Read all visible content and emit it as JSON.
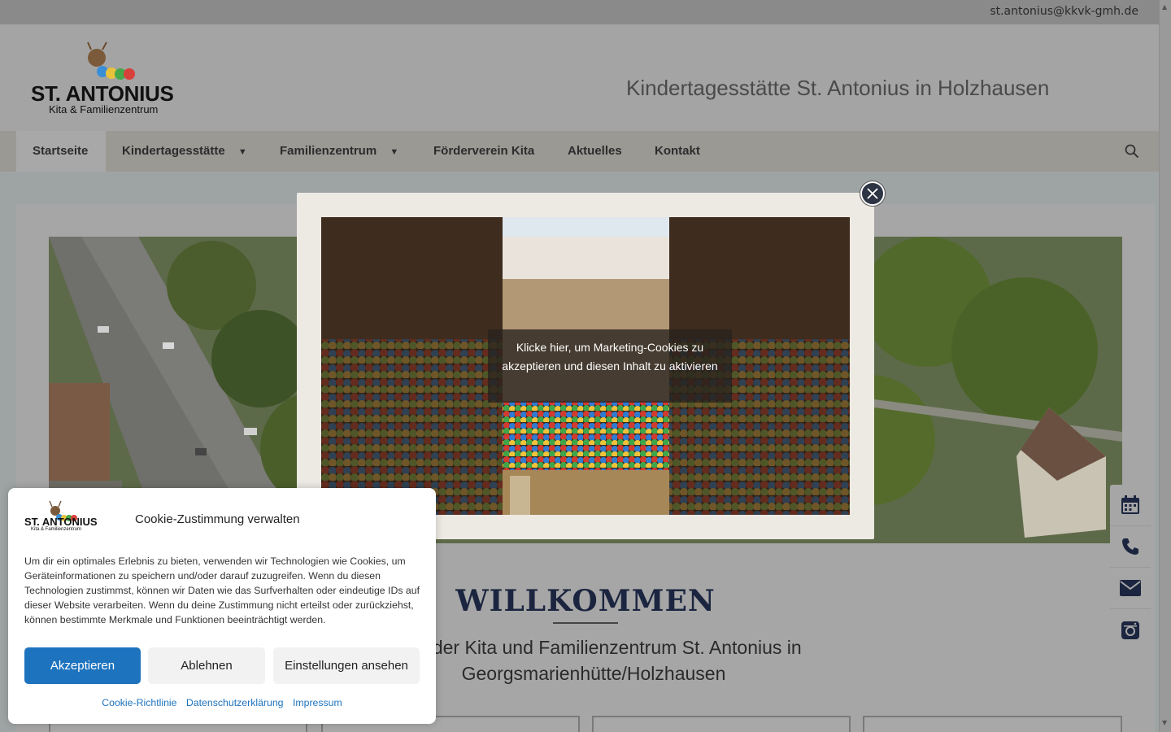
{
  "topbar": {
    "email": "st.antonius@kkvk-gmh.de"
  },
  "header": {
    "logo_name": "ST. ANTONIUS",
    "logo_sub": "Kita & Familienzentrum",
    "site_title": "Kindertagesstätte St. Antonius in Holzhausen"
  },
  "nav": {
    "items": [
      {
        "label": "Startseite"
      },
      {
        "label": "Kindertagesstätte"
      },
      {
        "label": "Familienzentrum"
      },
      {
        "label": "Förderverein Kita"
      },
      {
        "label": "Aktuelles"
      },
      {
        "label": "Kontakt"
      }
    ]
  },
  "main": {
    "welcome": "WILLKOMMEN",
    "intro": "page der Kita und Familienzentrum St. Antonius in Georgsmarienhütte/Holzhausen"
  },
  "lightbox": {
    "message": "Klicke hier, um Marketing-Cookies zu akzeptieren und diesen Inhalt zu aktivieren"
  },
  "cookie": {
    "title": "Cookie-Zustimmung verwalten",
    "text": "Um dir ein optimales Erlebnis zu bieten, verwenden wir Technologien wie Cookies, um Geräteinformationen zu speichern und/oder darauf zuzugreifen. Wenn du diesen Technologien zustimmst, können wir Daten wie das Surfverhalten oder eindeutige IDs auf dieser Website verarbeiten. Wenn du deine Zustimmung nicht erteilst oder zurückziehst, können bestimmte Merkmale und Funktionen beeinträchtigt werden.",
    "accept": "Akzeptieren",
    "deny": "Ablehnen",
    "prefs": "Einstellungen ansehen",
    "links": [
      "Cookie-Richtlinie",
      "Datenschutzerklärung",
      "Impressum"
    ]
  },
  "side_icons": [
    "calendar-icon",
    "phone-icon",
    "mail-icon",
    "instagram-icon"
  ],
  "colors": {
    "accent": "#1e73be",
    "nav_bg": "#9b9994",
    "dark_navy": "#1b2540"
  }
}
